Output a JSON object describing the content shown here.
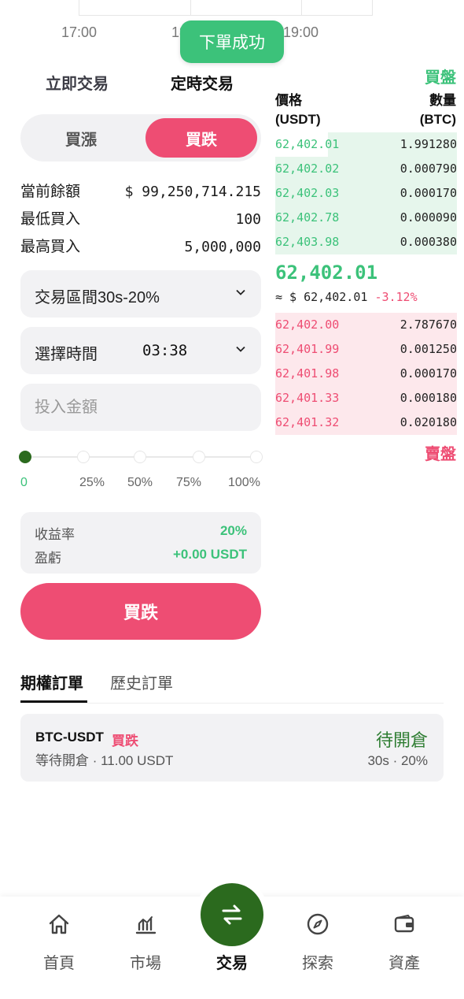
{
  "chart": {
    "time_labels": [
      "17:00",
      "18:00",
      "19:00"
    ]
  },
  "toast": {
    "text": "下單成功"
  },
  "trade_mode_tabs": {
    "instant": "立即交易",
    "scheduled": "定時交易"
  },
  "direction": {
    "up": "買漲",
    "down": "買跌",
    "selected": "買跌"
  },
  "account": {
    "balance_label": "當前餘額",
    "balance_value": "$ 99,250,714.215",
    "min_label": "最低買入",
    "min_value": "100",
    "max_label": "最高買入",
    "max_value": "5,000,000"
  },
  "interval_select": {
    "value": "交易區間30s-20%"
  },
  "time_select": {
    "label": "選擇時間",
    "value": "03:38"
  },
  "amount_input": {
    "placeholder": "投入金額",
    "value": ""
  },
  "slider": {
    "value_percent": 0,
    "marks": [
      "0",
      "25%",
      "50%",
      "75%",
      "100%"
    ]
  },
  "profit": {
    "rate_label": "收益率",
    "rate_value": "20%",
    "pnl_label": "盈虧",
    "pnl_value": "+0.00 USDT"
  },
  "submit_button": {
    "label": "買跌"
  },
  "order_book": {
    "buy_title": "買盤",
    "sell_title": "賣盤",
    "price_header": [
      "價格",
      "(USDT)"
    ],
    "qty_header": [
      "數量",
      "(BTC)"
    ],
    "bids": [
      {
        "price": "62,402.01",
        "qty": "1.991280"
      },
      {
        "price": "62,402.02",
        "qty": "0.000790"
      },
      {
        "price": "62,402.03",
        "qty": "0.000170"
      },
      {
        "price": "62,402.78",
        "qty": "0.000090"
      },
      {
        "price": "62,403.98",
        "qty": "0.000380"
      }
    ],
    "last_price": "62,402.01",
    "last_price_usd": "≈ $ 62,402.01",
    "change": "-3.12%",
    "asks": [
      {
        "price": "62,402.00",
        "qty": "2.787670"
      },
      {
        "price": "62,401.99",
        "qty": "0.001250"
      },
      {
        "price": "62,401.98",
        "qty": "0.000170"
      },
      {
        "price": "62,401.33",
        "qty": "0.000180"
      },
      {
        "price": "62,401.32",
        "qty": "0.020180"
      }
    ]
  },
  "order_tabs": {
    "options": "期權訂單",
    "history": "歷史訂單"
  },
  "orders": [
    {
      "pair": "BTC-USDT",
      "side": "買跌",
      "detail": "等待開倉 · 11.00 USDT",
      "status": "待開倉",
      "meta": "30s · 20%"
    }
  ],
  "bottom_nav": {
    "items": [
      {
        "label": "首頁",
        "icon": "home-icon"
      },
      {
        "label": "市場",
        "icon": "chart-icon"
      },
      {
        "label": "交易",
        "icon": "swap-icon"
      },
      {
        "label": "探索",
        "icon": "compass-icon"
      },
      {
        "label": "資產",
        "icon": "wallet-icon"
      }
    ],
    "active": "交易"
  },
  "colors": {
    "green": "#3cc27a",
    "red": "#ee4d73",
    "dark_green": "#2b6a1e"
  }
}
